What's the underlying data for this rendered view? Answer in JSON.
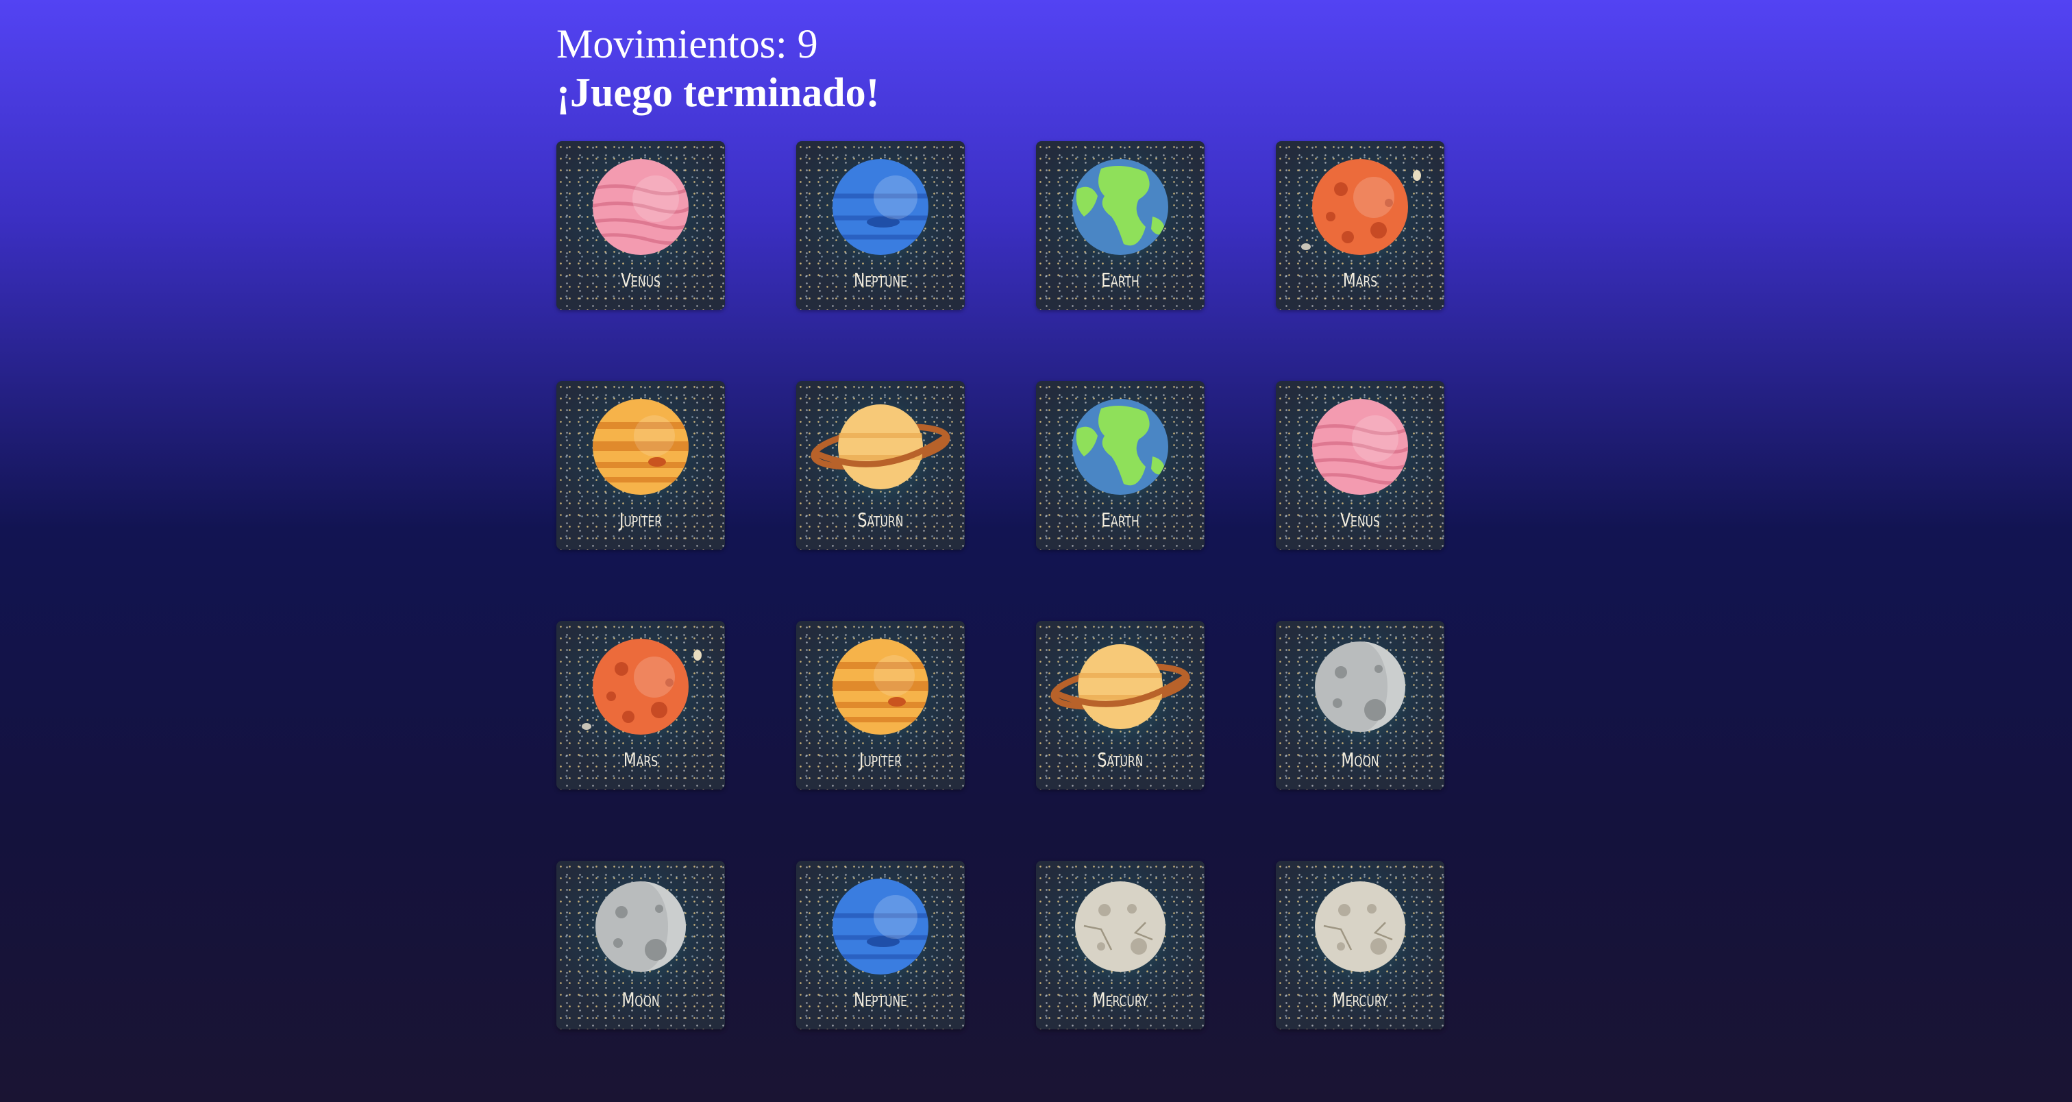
{
  "header": {
    "moves_label": "Movimientos: 9",
    "status": "¡Juego terminado!"
  },
  "cards": [
    {
      "name": "Venus",
      "kind": "venus"
    },
    {
      "name": "Neptune",
      "kind": "neptune"
    },
    {
      "name": "Earth",
      "kind": "earth"
    },
    {
      "name": "Mars",
      "kind": "mars"
    },
    {
      "name": "Jupiter",
      "kind": "jupiter"
    },
    {
      "name": "Saturn",
      "kind": "saturn"
    },
    {
      "name": "Earth",
      "kind": "earth"
    },
    {
      "name": "Venus",
      "kind": "venus"
    },
    {
      "name": "Mars",
      "kind": "mars"
    },
    {
      "name": "Jupiter",
      "kind": "jupiter"
    },
    {
      "name": "Saturn",
      "kind": "saturn"
    },
    {
      "name": "Moon",
      "kind": "moon"
    },
    {
      "name": "Moon",
      "kind": "moon"
    },
    {
      "name": "Neptune",
      "kind": "neptune"
    },
    {
      "name": "Mercury",
      "kind": "mercury"
    },
    {
      "name": "Mercury",
      "kind": "mercury"
    }
  ],
  "colors": {
    "venus": "#f39bb0",
    "neptune": "#3a7de0",
    "earth_ocean": "#4a86c5",
    "earth_land": "#8fe05a",
    "mars": "#ec6b3b",
    "jupiter": "#f6b34a",
    "saturn": "#f7c978",
    "moon": "#b9bcbd",
    "mercury": "#d8d3c6"
  }
}
